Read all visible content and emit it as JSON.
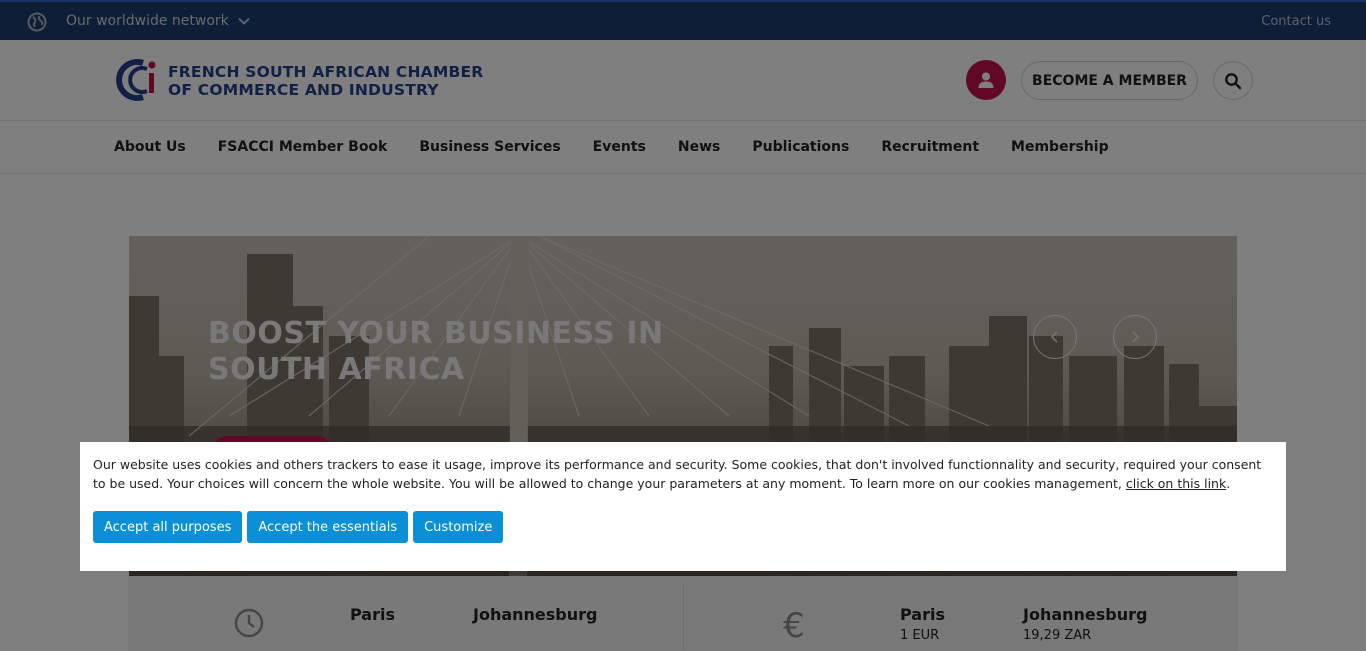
{
  "topbar": {
    "network_label": "Our worldwide network",
    "contact_label": "Contact us"
  },
  "header": {
    "logo_line1": "FRENCH SOUTH AFRICAN CHAMBER",
    "logo_line2": "OF COMMERCE AND INDUSTRY",
    "become_member_label": "BECOME A MEMBER"
  },
  "nav": {
    "items": [
      {
        "label": "About Us"
      },
      {
        "label": "FSACCI Member Book"
      },
      {
        "label": "Business Services"
      },
      {
        "label": "Events"
      },
      {
        "label": "News"
      },
      {
        "label": "Publications"
      },
      {
        "label": "Recruitment"
      },
      {
        "label": "Membership"
      }
    ]
  },
  "hero": {
    "title": "BOOST YOUR BUSINESS IN SOUTH AFRICA"
  },
  "info": {
    "time": {
      "city1": "Paris",
      "city2": "Johannesburg"
    },
    "currency": {
      "city1": "Paris",
      "value1": "1 EUR",
      "city2": "Johannesburg",
      "value2": "19,29 ZAR"
    }
  },
  "cookie": {
    "text": "Our website uses cookies and others trackers to ease it usage, improve its performance and security. Some cookies, that don't involved functionnality and security, required your consent to be used. Your choices will concern the whole website. You will be allowed to change your parameters at any moment. To learn more on our cookies management, ",
    "link_label": "click on this link",
    "text_end": ".",
    "accept_all_label": "Accept all purposes",
    "accept_essentials_label": "Accept the essentials",
    "customize_label": "Customize"
  },
  "colors": {
    "topbar": "#1c3d6e",
    "brand_blue": "#23438c",
    "brand_red": "#c0104d",
    "cookie_button": "#0b8fd6"
  }
}
